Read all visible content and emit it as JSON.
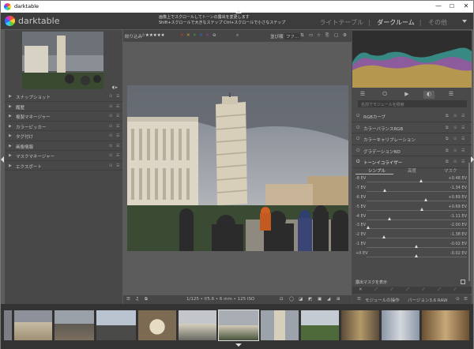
{
  "window": {
    "title": "darktable",
    "minimize": "—",
    "maximize": "☐",
    "close": "✕"
  },
  "header": {
    "brand": "darktable",
    "hint_line1": "画像上でスクロールしてトーンの露出を変更します",
    "hint_line2": "Shift+スクロールで大きなステップ    Ctrl+スクロールで小さなステップ",
    "views": [
      "ライトテーブル",
      "ダークルーム",
      "その他"
    ],
    "active_view": "ダークルーム"
  },
  "left_panel": {
    "modules": [
      {
        "label": "スナップショット"
      },
      {
        "label": "履歴"
      },
      {
        "label": "複製マネージャー"
      },
      {
        "label": "カラーピッカー"
      },
      {
        "label": "タグ付け"
      },
      {
        "label": "画像情報"
      },
      {
        "label": "マスクマネージャー"
      },
      {
        "label": "エクスポート"
      }
    ]
  },
  "toolbar": {
    "filter_label": "絞り込み",
    "stars": "☆★★★★★",
    "sort_label": "並び順",
    "sort_value": "ファ...",
    "colors": [
      "#d04030",
      "#d0b030",
      "#40a040",
      "#3070d0",
      "#a040b0"
    ]
  },
  "bottom_bar": {
    "exif": "1/125 • f/5.6 • 6 mm • 125 ISO"
  },
  "right_panel": {
    "search_placeholder": "名前でモジュールを検索",
    "modules": [
      {
        "label": "RGBカーブ"
      },
      {
        "label": "カラーバランスRGB"
      },
      {
        "label": "カラーキャリブレーション"
      },
      {
        "label": "グラデーションND"
      },
      {
        "label": "トーンイコライザー"
      }
    ],
    "subtabs": [
      "シンプル",
      "高度",
      "マスク"
    ],
    "active_subtab": "シンプル",
    "sliders": [
      {
        "label": "-8 EV",
        "value": "+0.48 EV",
        "pos": 0.55
      },
      {
        "label": "-7 EV",
        "value": "-1.34 EV",
        "pos": 0.17
      },
      {
        "label": "-6 EV",
        "value": "+0.89 EV",
        "pos": 0.6
      },
      {
        "label": "-5 EV",
        "value": "+0.69 EV",
        "pos": 0.56
      },
      {
        "label": "-4 EV",
        "value": "-1.11 EV",
        "pos": 0.22
      },
      {
        "label": "-3 EV",
        "value": "-2.00 EV",
        "pos": 0.0
      },
      {
        "label": "-2 EV",
        "value": "-1.38 EV",
        "pos": 0.16
      },
      {
        "label": "-1 EV",
        "value": "-0.02 EV",
        "pos": 0.5
      },
      {
        "label": "+0 EV",
        "value": "-0.02 EV",
        "pos": 0.5
      }
    ],
    "mask_label": "露出マスクを表示",
    "footer_label": "モジュールの操作",
    "footer_preset": "バージョン3.6 RAW"
  }
}
